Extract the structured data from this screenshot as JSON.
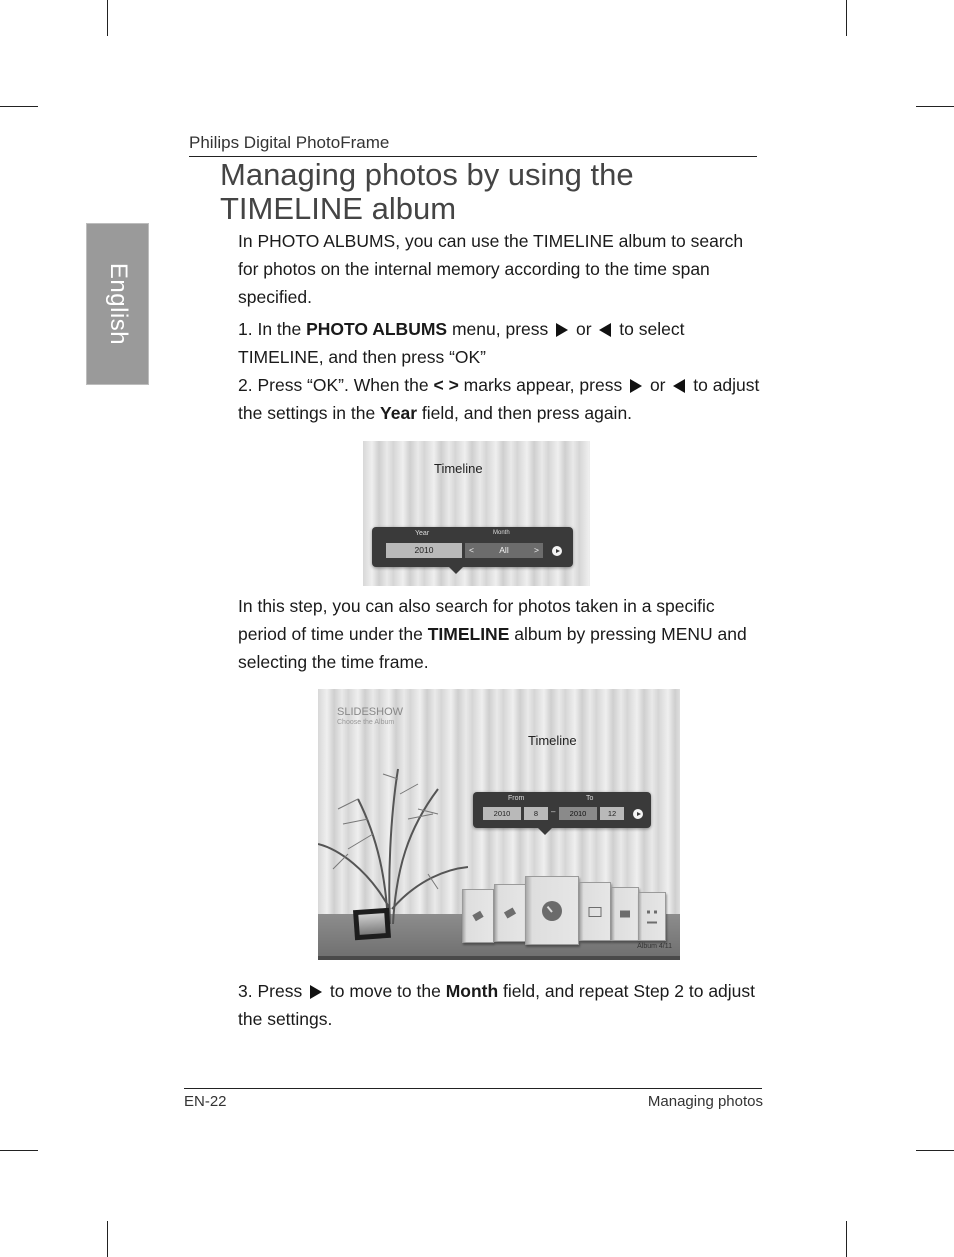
{
  "header": {
    "running_head": "Philips Digital PhotoFrame",
    "language_tab": "English"
  },
  "title": "Managing photos by using the TIMELINE album",
  "intro": "In PHOTO ALBUMS, you can use the TIMELINE album to search for photos on the internal memory according to the time span specified.",
  "steps": {
    "step1": {
      "prefix": "1.  In the ",
      "bold": "PHOTO ALBUMS",
      "mid": " menu, press ",
      "or": " or ",
      "suffix": " to select TIMELINE, and then press “OK”"
    },
    "step2": {
      "prefix": "2.  Press “OK”. When the ",
      "marks": "< >",
      "mid": " marks appear, press ",
      "or": " or ",
      "mid2": " to adjust the settings in the ",
      "bold": "Year",
      "suffix": " field, and then press again."
    },
    "step3": {
      "prefix": "3.  Press ",
      "mid": " to move to the ",
      "bold": "Month",
      "suffix": " field, and repeat Step 2 to adjust the settings."
    }
  },
  "middle_text": {
    "prefix": "In this step, you can also search for photos taken in a specific period of time under the ",
    "bold": "TIMELINE",
    "suffix": " album by pressing MENU and selecting the time frame."
  },
  "screenshot1": {
    "title": "Timeline",
    "year_label": "Year",
    "month_label": "Month",
    "year_value": "2010",
    "month_value": "All",
    "left_arrow": "<",
    "right_arrow": ">"
  },
  "screenshot2": {
    "section": "SLIDESHOW",
    "subtitle": "Choose the Album",
    "title": "Timeline",
    "from_label": "From",
    "to_label": "To",
    "from_year": "2010",
    "from_month": "8",
    "dash": "–",
    "to_year": "2010",
    "to_month": "12",
    "album_count": "Album 4/11"
  },
  "footer": {
    "page_number": "EN-22",
    "section": "Managing photos"
  }
}
